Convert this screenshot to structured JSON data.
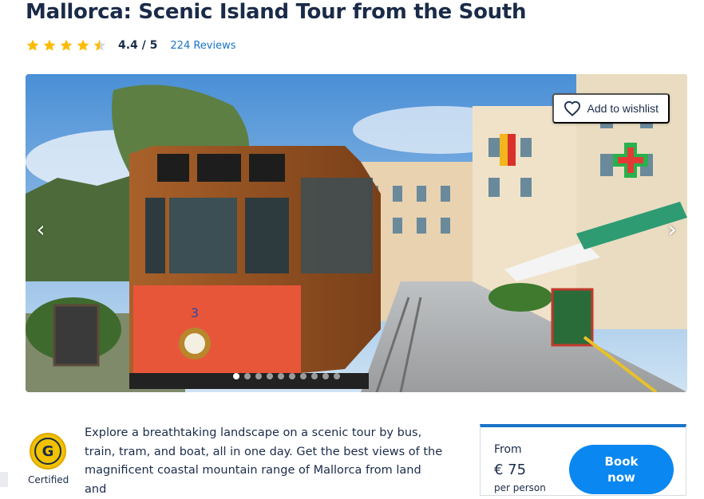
{
  "tour": {
    "title": "Mallorca: Scenic Island Tour from the South",
    "rating": 4.4,
    "rating_text": "4.4 / 5",
    "reviews_link": "224 Reviews",
    "star_color": "#fbbc05"
  },
  "gallery": {
    "wishlist_label": "Add to wishlist",
    "prev_arrow": "‹",
    "next_arrow": "›",
    "image_count": 10,
    "active_index": 0,
    "tram_number": "3"
  },
  "badge": {
    "icon": "G",
    "label": "Certified"
  },
  "description": "Explore a breathtaking landscape on a scenic tour by bus, train, tram, and boat, all in one day. Get the best views of the magnificent coastal mountain range of Mallorca from land and",
  "booking": {
    "from_label": "From",
    "price": "€ 75",
    "per_person": "per person",
    "button_label_line1": "Book",
    "button_label_line2": "now",
    "accent_color": "#1a73c9"
  }
}
